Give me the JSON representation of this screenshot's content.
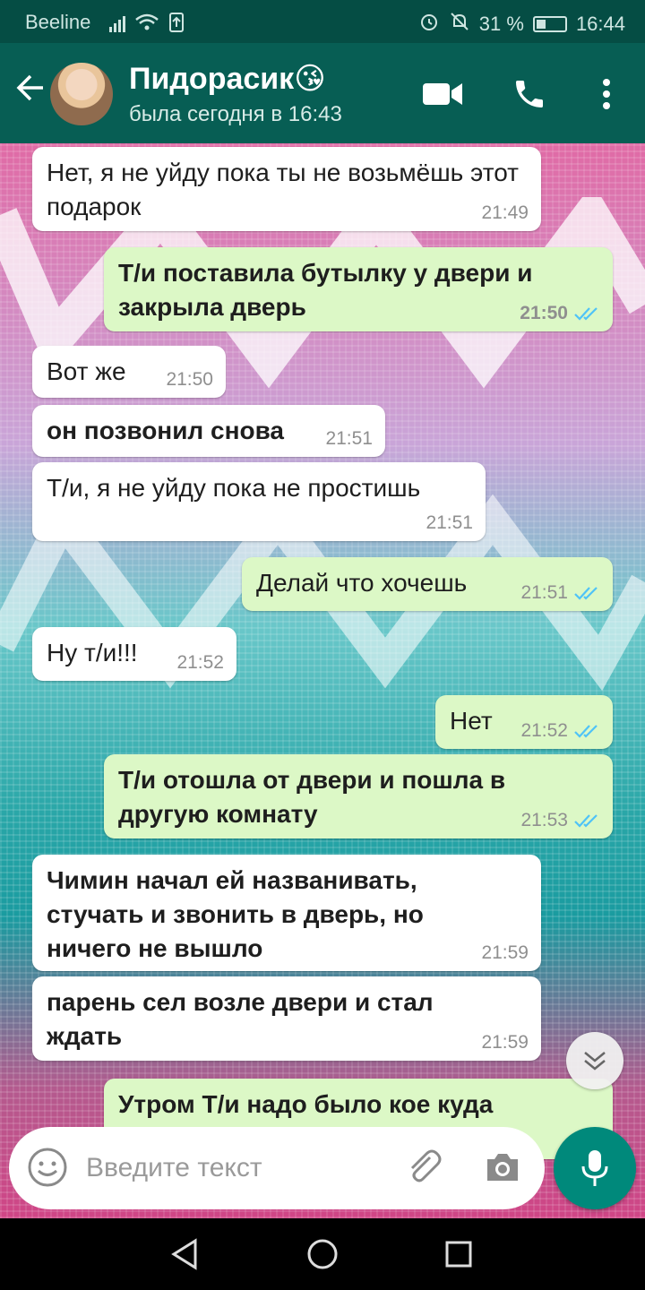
{
  "status_bar": {
    "carrier": "Beeline",
    "battery": "31 %",
    "time": "16:44"
  },
  "header": {
    "contact_name": "Пидорасик😘",
    "status": "была сегодня в 16:43"
  },
  "messages": [
    {
      "text": "Нет, я не уйду пока ты не возьмёшь этот подарок",
      "time": "21:49",
      "direction": "in"
    },
    {
      "text": "Т/и поставила бутылку у двери и закрыла дверь",
      "time": "21:50",
      "direction": "out"
    },
    {
      "text": "Вот же",
      "time": "21:50",
      "direction": "in"
    },
    {
      "text": "он позвонил снова",
      "time": "21:51",
      "direction": "in"
    },
    {
      "text": "Т/и, я не уйду пока не простишь",
      "time": "21:51",
      "direction": "in"
    },
    {
      "text": "Делай что хочешь",
      "time": "21:51",
      "direction": "out"
    },
    {
      "text": "Ну т/и!!!",
      "time": "21:52",
      "direction": "in"
    },
    {
      "text": "Нет",
      "time": "21:52",
      "direction": "out"
    },
    {
      "text": "Т/и отошла от двери и пошла в другую комнату",
      "time": "21:53",
      "direction": "out"
    },
    {
      "text": "Чимин начал ей названивать, стучать и звонить в дверь, но ничего не вышло",
      "time": "21:59",
      "direction": "in"
    },
    {
      "text": "парень сел возле двери и стал ждать",
      "time": "21:59",
      "direction": "in"
    },
    {
      "text": "Утром Т/и надо было кое куда",
      "time": "",
      "direction": "out"
    }
  ],
  "input": {
    "placeholder": "Введите текст"
  },
  "colors": {
    "header": "#075e54",
    "status_bar": "#054d44",
    "incoming_bubble": "#ffffff",
    "outgoing_bubble": "#dcf8c6",
    "read_ticks": "#4fc3f7",
    "mic_button": "#00897b"
  },
  "icons": [
    "back-arrow-icon",
    "video-call-icon",
    "phone-icon",
    "more-vert-icon",
    "double-check-icon",
    "chevron-down-icon",
    "emoji-icon",
    "paperclip-icon",
    "camera-icon",
    "mic-icon",
    "nav-back-icon",
    "nav-home-icon",
    "nav-recents-icon"
  ]
}
